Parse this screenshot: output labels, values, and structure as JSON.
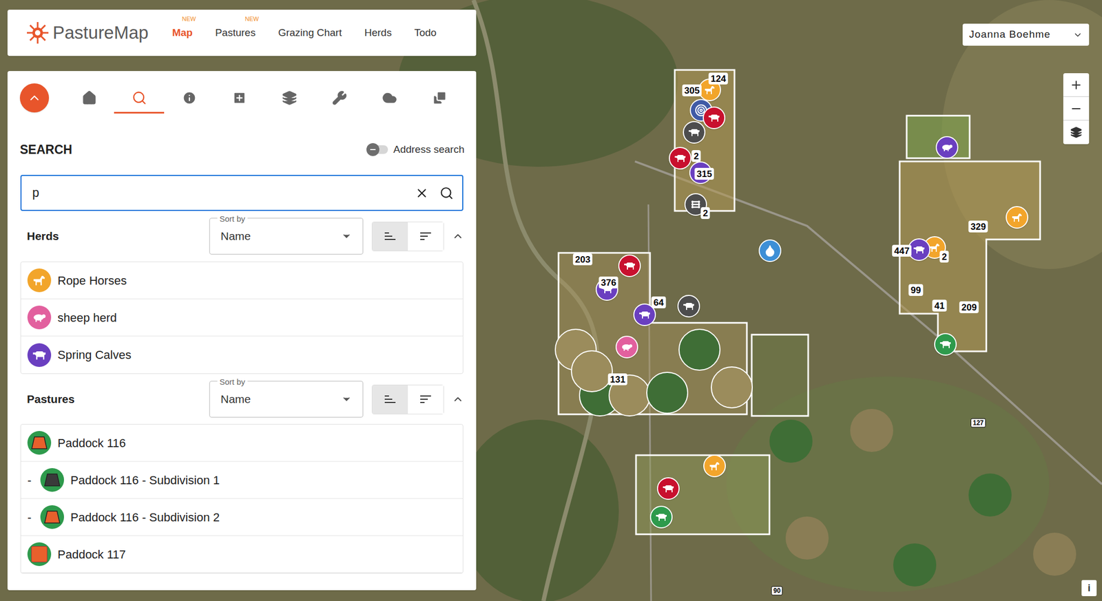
{
  "app": {
    "logo": "PastureMap"
  },
  "nav": [
    {
      "label": "Map",
      "badge": "NEW",
      "selected": true
    },
    {
      "label": "Pastures",
      "badge": "NEW",
      "selected": false
    },
    {
      "label": "Grazing Chart",
      "badge": "",
      "selected": false
    },
    {
      "label": "Herds",
      "badge": "",
      "selected": false
    },
    {
      "label": "Todo",
      "badge": "",
      "selected": false
    }
  ],
  "user": {
    "name": "Joanna Boehme"
  },
  "toolbar": {
    "collapse_expanded": true,
    "tools": [
      {
        "selected": false
      },
      {
        "selected": true
      },
      {
        "selected": false
      },
      {
        "selected": false
      },
      {
        "selected": false
      },
      {
        "selected": false
      },
      {
        "selected": false
      },
      {
        "selected": false
      }
    ]
  },
  "search": {
    "title": "SEARCH",
    "address_search": {
      "label": "Address search",
      "on": false
    },
    "value": "p"
  },
  "herds": {
    "title": "Herds",
    "expanded": true,
    "sort": {
      "label": "Sort by",
      "value": "Name"
    },
    "order": [
      {
        "selected": true
      },
      {
        "selected": false
      }
    ],
    "items": [
      {
        "name": "Rope Horses",
        "color": "#f2a52b",
        "kind": "horse"
      },
      {
        "name": "sheep herd",
        "color": "#e2609e",
        "kind": "sheep"
      },
      {
        "name": "Spring Calves",
        "color": "#6a3fc0",
        "kind": "cow"
      }
    ]
  },
  "pastures": {
    "title": "Pastures",
    "expanded": true,
    "sort": {
      "label": "Sort by",
      "value": "Name"
    },
    "order": [
      {
        "selected": true
      },
      {
        "selected": false
      }
    ],
    "items": [
      {
        "name": "Paddock 116",
        "prefix": "",
        "color": "#e8602c",
        "kind": "trapezoid"
      },
      {
        "name": "Paddock 116 - Subdivision 1",
        "prefix": "-",
        "color": "#3a3a3a",
        "kind": "trapezoid"
      },
      {
        "name": "Paddock 116 - Subdivision 2",
        "prefix": "-",
        "color": "#e8602c",
        "kind": "trapezoid"
      },
      {
        "name": "Paddock 117",
        "prefix": "",
        "color": "#e8602c",
        "kind": "square"
      }
    ]
  },
  "map": {
    "labels": [
      "124",
      "305",
      "315",
      "2",
      "2",
      "329",
      "447",
      "2",
      "99",
      "41",
      "209",
      "203",
      "376",
      "64",
      "131"
    ],
    "pins": [
      {
        "kind": "horse",
        "color": "#f2a52b"
      },
      {
        "kind": "target",
        "color": "#3f5aa6"
      },
      {
        "kind": "cow",
        "color": "#c8102e"
      },
      {
        "kind": "cow",
        "color": "#4d4d4d"
      },
      {
        "kind": "cow",
        "color": "#c8102e"
      },
      {
        "kind": "cow",
        "color": "#6a3fc0"
      },
      {
        "kind": "fence",
        "color": "#4d4d4d"
      },
      {
        "kind": "sheep",
        "color": "#6a3fc0"
      },
      {
        "kind": "horse",
        "color": "#f2a52b"
      },
      {
        "kind": "horse",
        "color": "#f2a52b"
      },
      {
        "kind": "cow",
        "color": "#6a3fc0"
      },
      {
        "kind": "water",
        "color": "#3d8fd6"
      },
      {
        "kind": "cow",
        "color": "#c8102e"
      },
      {
        "kind": "cow",
        "color": "#6a3fc0"
      },
      {
        "kind": "cow",
        "color": "#6a3fc0"
      },
      {
        "kind": "cow",
        "color": "#4d4d4d"
      },
      {
        "kind": "sheep",
        "color": "#e2609e"
      },
      {
        "kind": "cow",
        "color": "#2e9a4c"
      },
      {
        "kind": "horse",
        "color": "#f2a52b"
      },
      {
        "kind": "cow",
        "color": "#c8102e"
      },
      {
        "kind": "cow",
        "color": "#2e9a4c"
      }
    ],
    "road_signs": [
      "127",
      "90"
    ]
  },
  "controls": {
    "info": "i"
  }
}
